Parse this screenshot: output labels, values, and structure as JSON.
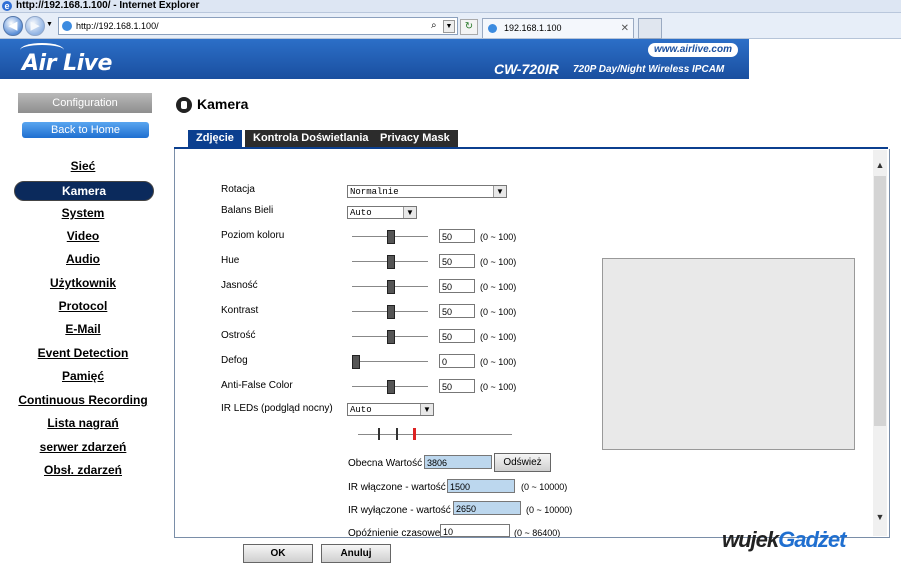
{
  "browser": {
    "title": "http://192.168.1.100/ - Internet Explorer",
    "address": "http://192.168.1.100/",
    "tab_title": "192.168.1.100"
  },
  "banner": {
    "logo": "Air Live",
    "website": "www.airlive.com",
    "model": "CW-720IR",
    "model_desc": "720P Day/Night Wireless IPCAM"
  },
  "sidebar": {
    "config_button": "Configuration",
    "home_button": "Back to Home",
    "items": [
      "Sieć",
      "Kamera",
      "System",
      "Video",
      "Audio",
      "Użytkownik",
      "Protocol",
      "E-Mail",
      "Event Detection",
      "Pamięć",
      "Continuous Recording",
      "Lista nagrań",
      "serwer zdarzeń",
      "Obsł. zdarzeń"
    ],
    "active_index": 1
  },
  "page": {
    "title": "Kamera",
    "tabs": [
      "Zdjęcie",
      "Kontrola Doświetlania",
      "Privacy Mask"
    ]
  },
  "form": {
    "rotation_label": "Rotacja",
    "rotation_value": "Normalnie",
    "wb_label": "Balans Bieli",
    "wb_value": "Auto",
    "sliders": [
      {
        "label": "Poziom koloru",
        "value": "50",
        "range": "(0 ~ 100)",
        "level": 0.5
      },
      {
        "label": "Hue",
        "value": "50",
        "range": "(0 ~ 100)",
        "level": 0.5
      },
      {
        "label": "Jasność",
        "value": "50",
        "range": "(0 ~ 100)",
        "level": 0.5
      },
      {
        "label": "Kontrast",
        "value": "50",
        "range": "(0 ~ 100)",
        "level": 0.5
      },
      {
        "label": "Ostrość",
        "value": "50",
        "range": "(0 ~ 100)",
        "level": 0.5
      },
      {
        "label": "Defog",
        "value": "0",
        "range": "(0 ~ 100)",
        "level": 0
      },
      {
        "label": "Anti-False Color",
        "value": "50",
        "range": "(0 ~ 100)",
        "level": 0.5
      }
    ],
    "ir_label": "IR LEDs (podgląd nocny)",
    "ir_value": "Auto",
    "current_label": "Obecna Wartość",
    "current_value": "3806",
    "refresh_button": "Odśwież",
    "ir_on_label": "IR włączone - wartość",
    "ir_on_value": "1500",
    "ir_on_range": "(0 ~ 10000)",
    "ir_off_label": "IR wyłączone - wartość",
    "ir_off_value": "2650",
    "ir_off_range": "(0 ~ 10000)",
    "delay_label": "Opóźnienie czasowe",
    "delay_value": "10",
    "delay_range": "(0 ~ 86400)"
  },
  "footer": {
    "ok_button": "OK",
    "cancel_button": "Anuluj"
  },
  "watermark": {
    "part1": "wujek",
    "part2": "Gadżet"
  },
  "colors": {
    "banner": "#1a4f9f",
    "active_nav": "#0b2a5c",
    "tab": "#2c2c2c",
    "field_highlight": "#bcd7ee"
  }
}
